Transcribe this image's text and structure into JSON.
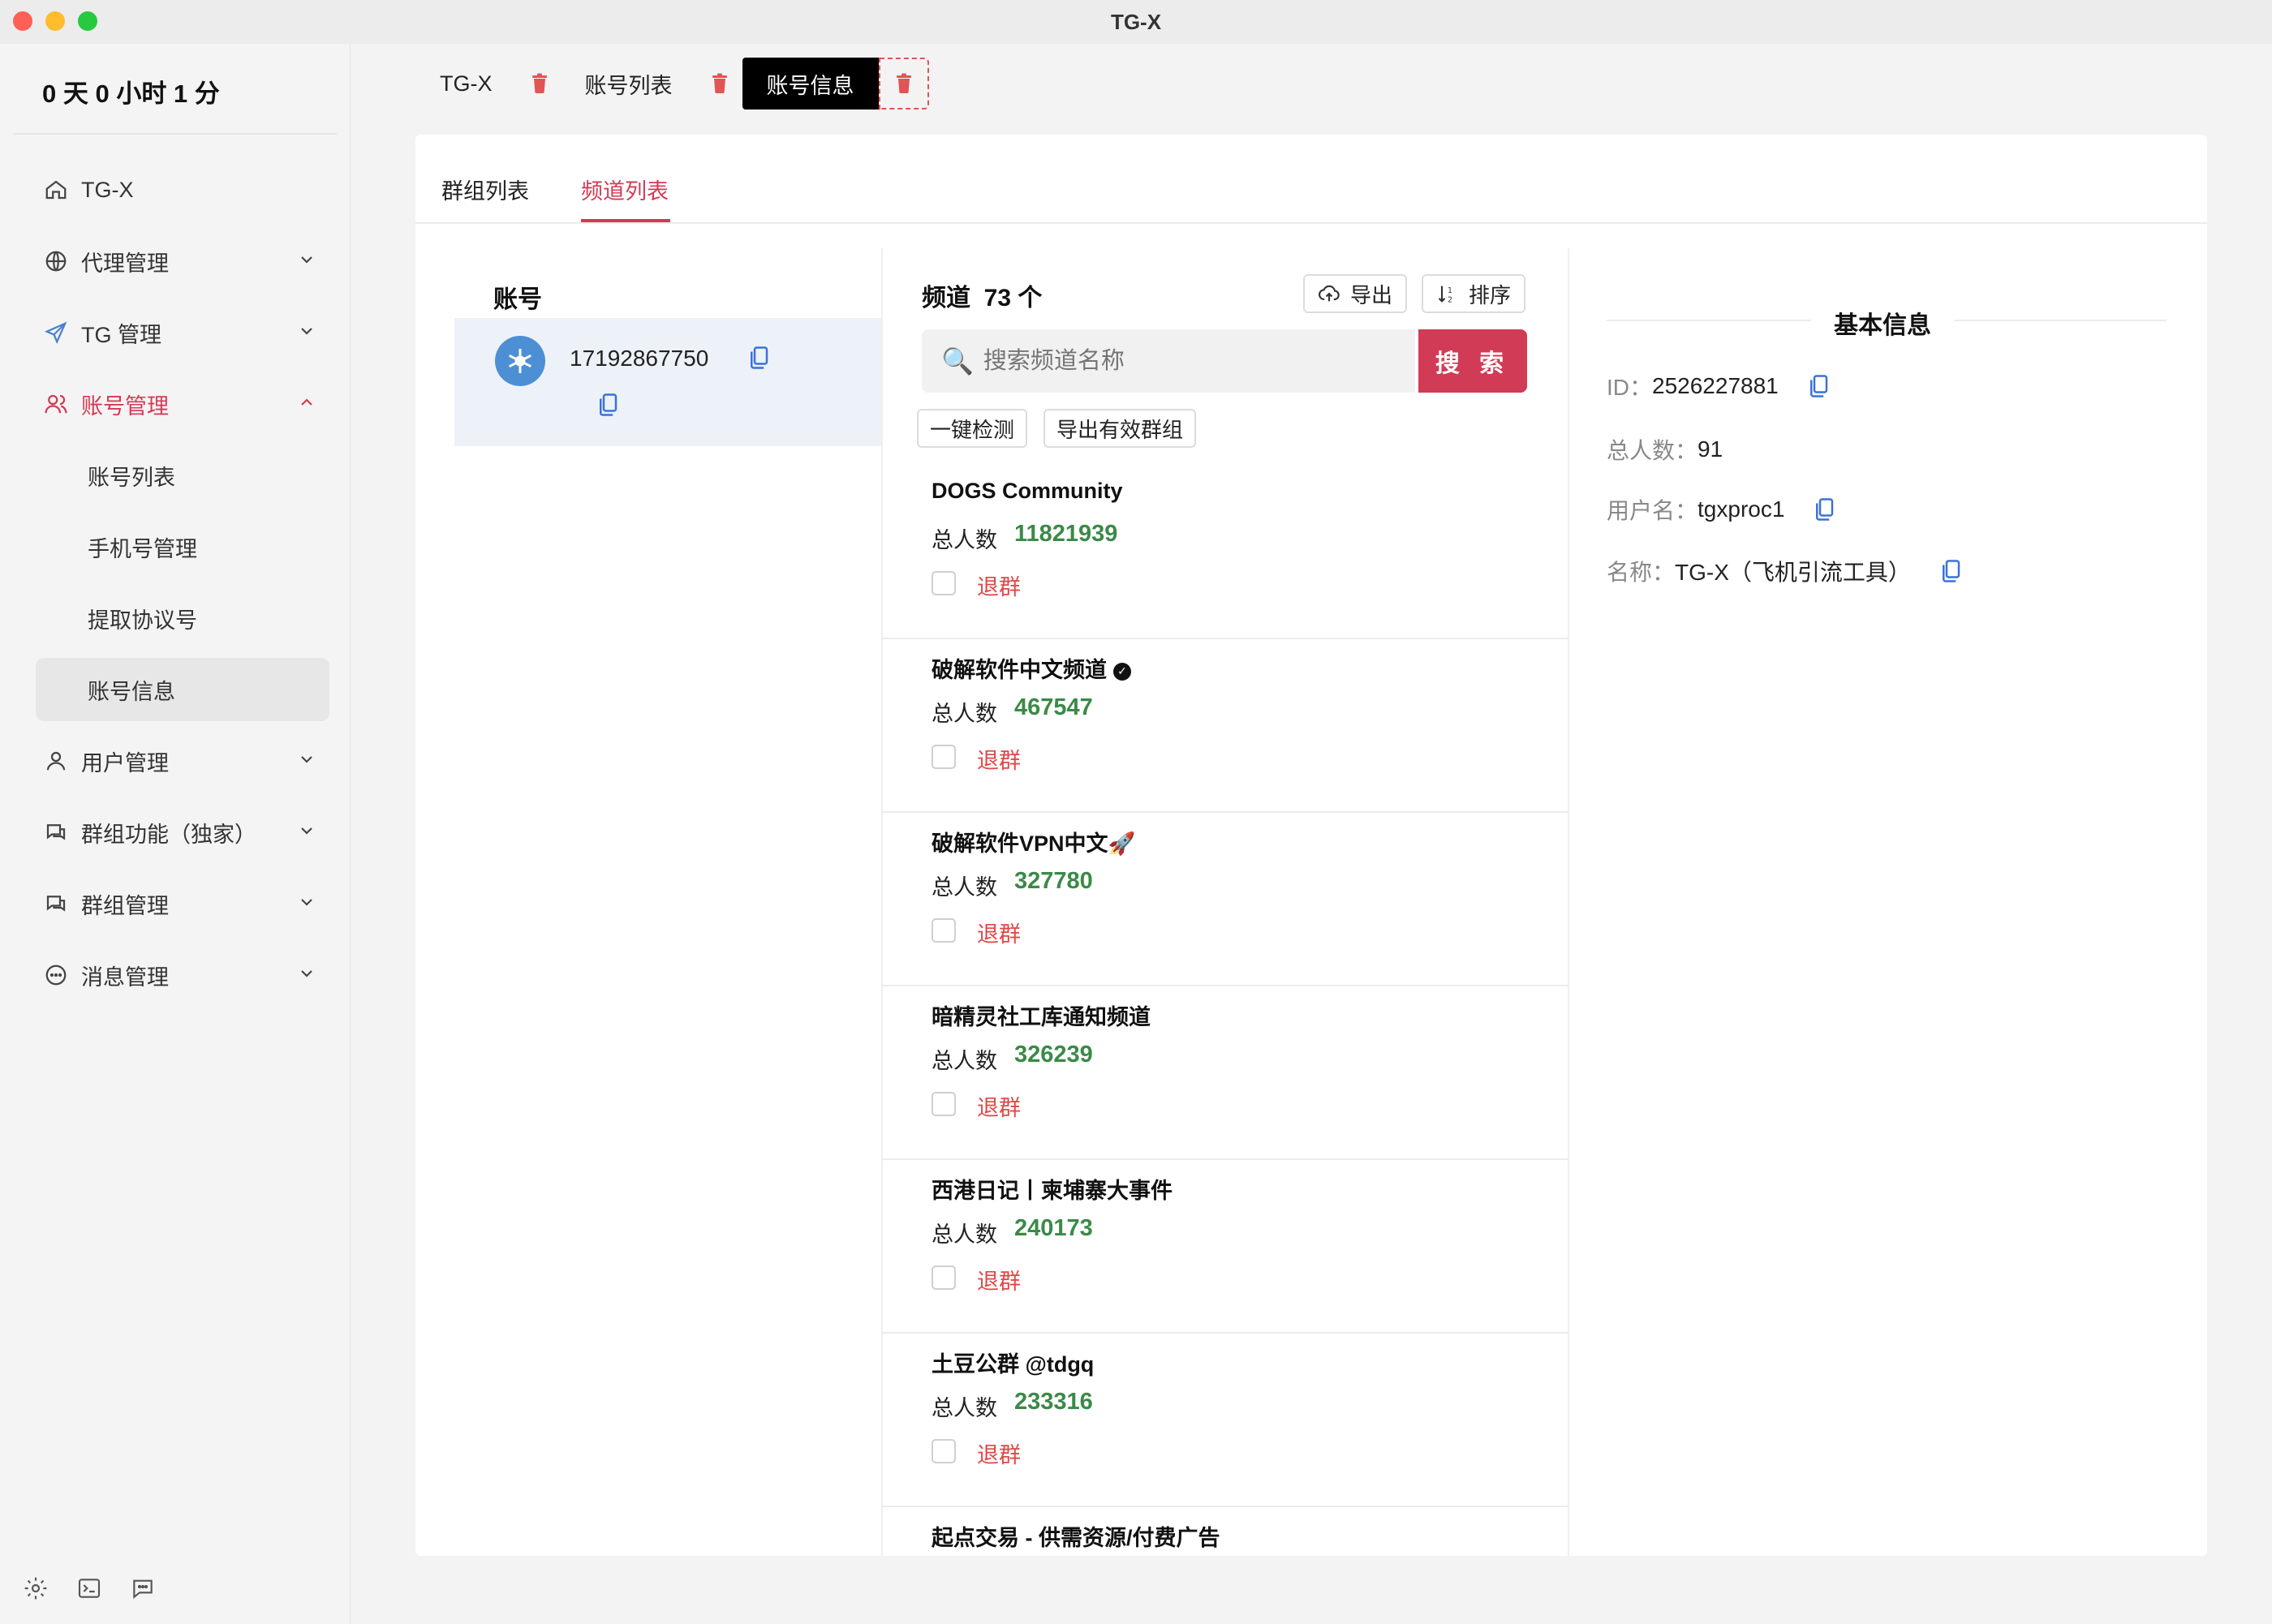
{
  "window": {
    "title": "TG-X"
  },
  "sidebar": {
    "uptime": "0 天 0 小时 1 分",
    "items": [
      {
        "label": "TG-X",
        "icon": "home-icon",
        "expandable": false
      },
      {
        "label": "代理管理",
        "icon": "globe-icon",
        "expandable": true
      },
      {
        "label": "TG 管理",
        "icon": "paper-plane-icon",
        "expandable": true
      },
      {
        "label": "账号管理",
        "icon": "users-icon",
        "expandable": true,
        "active": true
      },
      {
        "label": "用户管理",
        "icon": "user-icon",
        "expandable": true
      },
      {
        "label": "群组功能（独家）",
        "icon": "chat-bubbles-icon",
        "expandable": true
      },
      {
        "label": "群组管理",
        "icon": "chat-bubbles-icon",
        "expandable": true
      },
      {
        "label": "消息管理",
        "icon": "message-icon",
        "expandable": true
      }
    ],
    "sub_items": [
      {
        "label": "账号列表"
      },
      {
        "label": "手机号管理"
      },
      {
        "label": "提取协议号"
      },
      {
        "label": "账号信息",
        "selected": true
      }
    ]
  },
  "tabs": [
    {
      "label": "TG-X"
    },
    {
      "label": "账号列表"
    },
    {
      "label": "账号信息",
      "active": true
    }
  ],
  "subtabs": [
    {
      "label": "群组列表"
    },
    {
      "label": "频道列表",
      "active": true
    }
  ],
  "account": {
    "title": "账号",
    "phone": "17192867750"
  },
  "channels": {
    "title": "频道",
    "count_text": "73 个",
    "export_label": "导出",
    "sort_label": "排序",
    "search_placeholder": "搜索频道名称",
    "search_button": "搜 索",
    "check_all_label": "一键检测",
    "export_valid_label": "导出有效群组",
    "count_label": "总人数",
    "leave_label": "退群",
    "list": [
      {
        "name": "DOGS Community",
        "count": "11821939"
      },
      {
        "name": "破解软件中文频道",
        "count": "467547",
        "verified": true
      },
      {
        "name": "破解软件VPN中文🚀",
        "count": "327780"
      },
      {
        "name": "暗精灵社工库通知频道",
        "count": "326239"
      },
      {
        "name": "西港日记丨柬埔寨大事件",
        "count": "240173"
      },
      {
        "name": "土豆公群 @tdgq",
        "count": "233316"
      },
      {
        "name": "起点交易 - 供需资源/付费广告",
        "count": ""
      }
    ]
  },
  "info": {
    "title": "基本信息",
    "id_label": "ID：",
    "id_value": "2526227881",
    "members_label": "总人数：",
    "members_value": "91",
    "username_label": "用户名：",
    "username_value": "tgxproc1",
    "name_label": "名称：",
    "name_value": "TG-X（飞机引流工具）"
  },
  "colors": {
    "accent": "#d23b55",
    "count_green": "#3a8a47",
    "leave_red": "#e04848",
    "delete_red": "#e05555"
  }
}
